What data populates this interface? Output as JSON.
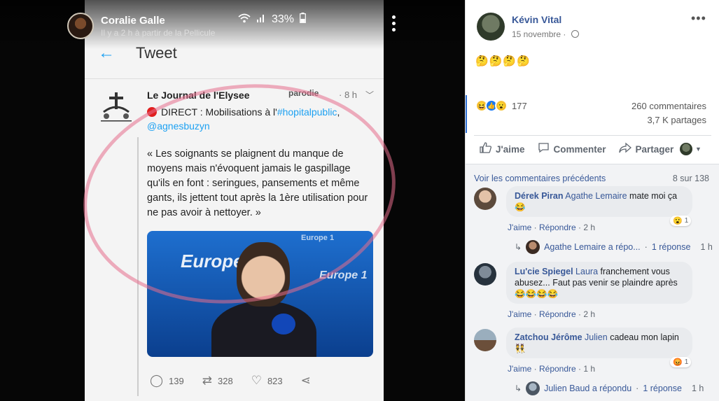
{
  "media": {
    "poster_name": "Coralie Galle",
    "poster_subtitle": "Il y a 2 h à partir de la Pellicule",
    "battery": "33%",
    "tweet": {
      "header_title": "Tweet",
      "account_name": "Le Journal de l'Elysee",
      "parody_label": "parodie",
      "time": "· 8 h",
      "direct_prefix": "DIRECT : Mobilisations à l'",
      "hashtag": "#hopitalpublic",
      "comma": ",",
      "mention": "@agnesbuzyn",
      "quote": "« Les soignants se plaignent du manque de moyens mais n'évoquent jamais le gaspillage qu'ils en font : seringues, pansements et même gants, ils jettent tout après la 1ère utilisation pour ne pas avoir à nettoyer. »",
      "image_brand": "Europe 1",
      "image_brand_small": "Europe 1",
      "image_brand_top": "Europe 1",
      "replies": "139",
      "retweets": "328",
      "likes": "823"
    }
  },
  "post": {
    "author": "Kévin Vital",
    "date": "15 novembre",
    "more": "•••",
    "emoji_text": "🤔🤔🤔🤔",
    "reaction_count": "177",
    "comments_count": "260 commentaires",
    "shares_count": "3,7 K partages",
    "actions": {
      "like": "J'aime",
      "comment": "Commenter",
      "share": "Partager"
    }
  },
  "comments_section": {
    "view_previous": "Voir les commentaires précédents",
    "count": "8 sur 138",
    "items": [
      {
        "author": "Dérek Piran",
        "mention": "Agathe Lemaire",
        "text": "mate moi ça",
        "emoji": "😂",
        "like": "J'aime",
        "reply": "Répondre",
        "time": "2 h",
        "reaction_emoji": "😮",
        "reaction_count": "1",
        "reply_summary": {
          "name": "Agathe Lemaire a répo...",
          "replies": "1 réponse",
          "time": "1 h"
        }
      },
      {
        "author": "Lu'cie Spiegel",
        "mention": "Laura",
        "text": "franchement vous abusez... Faut pas venir se plaindre après",
        "emoji": "😂😂😂😂",
        "like": "J'aime",
        "reply": "Répondre",
        "time": "2 h"
      },
      {
        "author": "Zatchou Jérôme",
        "mention": "Julien",
        "text": "cadeau mon lapin",
        "emoji": "👯",
        "like": "J'aime",
        "reply": "Répondre",
        "time": "1 h",
        "reaction_emoji": "😡",
        "reaction_count": "1",
        "reply_summary": {
          "name": "Julien Baud a répondu",
          "replies": "1 réponse",
          "time": "1 h"
        }
      }
    ]
  },
  "colors": {
    "link_blue": "#385898",
    "twitter_blue": "#1da1f2",
    "highlight_circle": "#e66e8c"
  }
}
